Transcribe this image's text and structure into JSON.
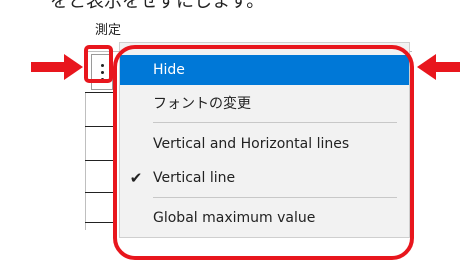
{
  "top_caption": "をと表示をせずにします。",
  "panel": {
    "title": "測定"
  },
  "context_menu": {
    "items": [
      {
        "label": "Hide",
        "checked": false,
        "highlighted": true
      },
      {
        "label": "フォントの変更",
        "checked": false,
        "highlighted": false
      },
      {
        "label": "Vertical and Horizontal lines",
        "checked": false,
        "highlighted": false
      },
      {
        "label": "Vertical line",
        "checked": true,
        "highlighted": false
      },
      {
        "label": "Global maximum value",
        "checked": false,
        "highlighted": false
      }
    ],
    "check_mark": "✔"
  },
  "colors": {
    "highlight_blue": "#0078d7",
    "annotation_red": "#e8161d",
    "menu_bg": "#f2f2f2"
  },
  "icons": {
    "menu_button": "kebab-menu-icon",
    "left_arrow": "right-pointing-arrow-icon",
    "right_arrow": "left-pointing-arrow-icon"
  }
}
